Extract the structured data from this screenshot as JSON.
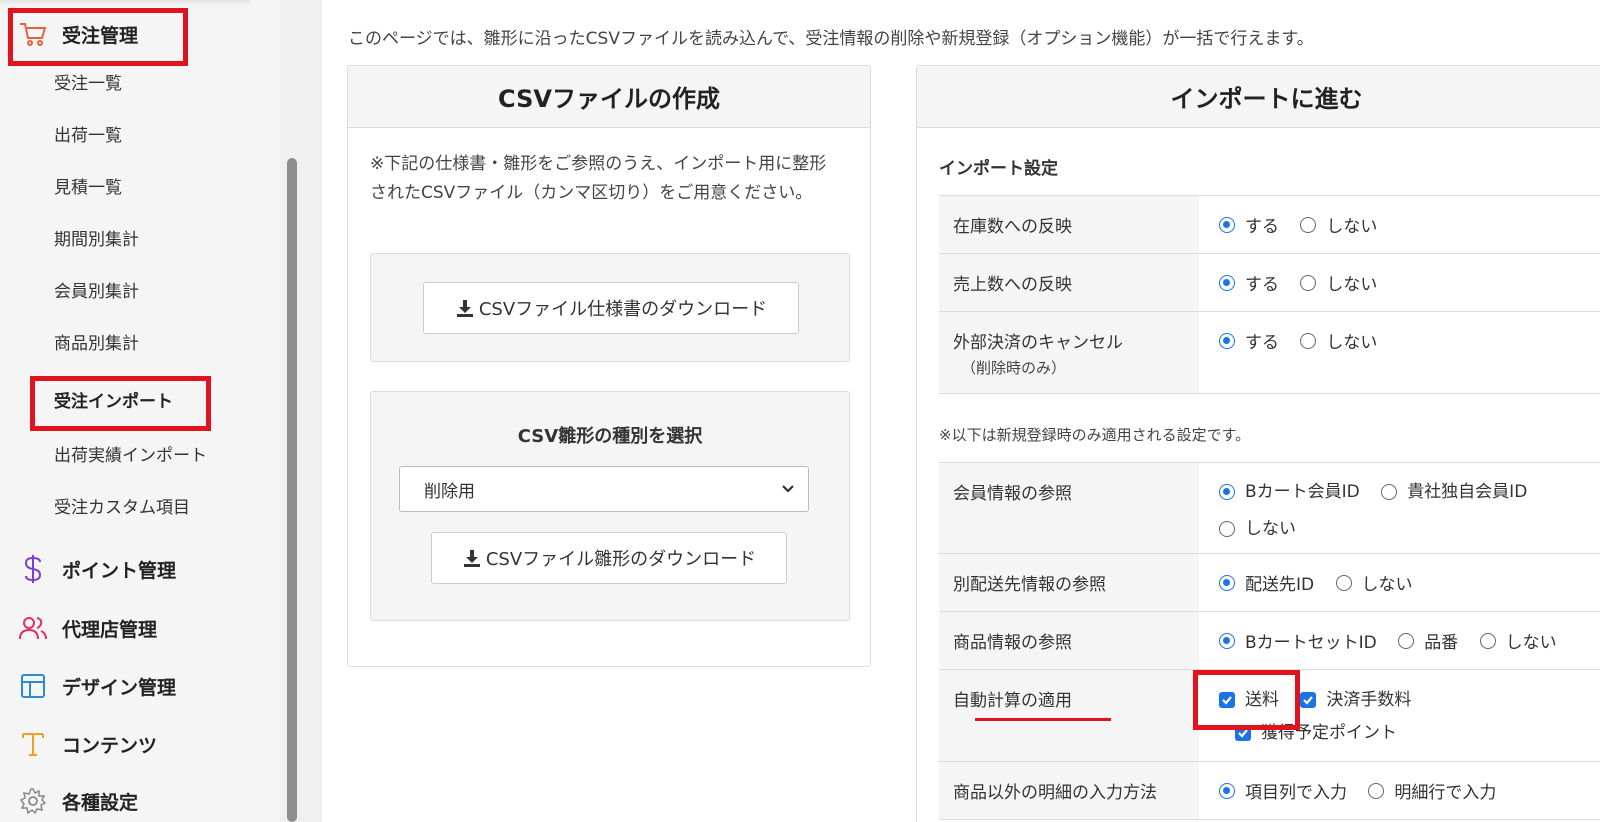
{
  "sidebar": {
    "order_management": "受注管理",
    "order_sub_items": [
      "受注一覧",
      "出荷一覧",
      "見積一覧",
      "期間別集計",
      "会員別集計",
      "商品別集計",
      "受注インポート",
      "出荷実績インポート",
      "受注カスタム項目"
    ],
    "point_management": "ポイント管理",
    "agency_management": "代理店管理",
    "design_management": "デザイン管理",
    "contents": "コンテンツ",
    "settings": "各種設定",
    "icon_colors": {
      "cart": "#e8603c",
      "point": "#7b3fd0",
      "agency": "#e0306e",
      "design": "#2b8ad6",
      "contents": "#f0a020",
      "settings": "#888888"
    }
  },
  "intro": "このページでは、雛形に沿ったCSVファイルを読み込んで、受注情報の削除や新規登録（オプション機能）が一括で行えます。",
  "csv_panel": {
    "title": "CSVファイルの作成",
    "note": "※下記の仕様書・雛形をご参照のうえ、インポート用に整形されたCSVファイル（カンマ区切り）をご用意ください。",
    "spec_download": "CSVファイル仕様書のダウンロード",
    "select_label": "CSV雛形の種別を選択",
    "select_value": "削除用",
    "template_download": "CSVファイル雛形のダウンロード"
  },
  "import_panel": {
    "title": "インポートに進む",
    "section_title": "インポート設定",
    "rows_top": [
      {
        "label": "在庫数への反映",
        "sub": "",
        "options": [
          "する",
          "しない"
        ],
        "selected": 0
      },
      {
        "label": "売上数への反映",
        "sub": "",
        "options": [
          "する",
          "しない"
        ],
        "selected": 0
      },
      {
        "label": "外部決済のキャンセル",
        "sub": "（削除時のみ）",
        "options": [
          "する",
          "しない"
        ],
        "selected": 0
      }
    ],
    "new_only_note": "※以下は新規登録時のみ適用される設定です。",
    "member_ref": {
      "label": "会員情報の参照",
      "options": [
        "Bカート会員ID",
        "貴社独自会員ID",
        "しない"
      ],
      "selected": 0
    },
    "shipping_ref": {
      "label": "別配送先情報の参照",
      "options": [
        "配送先ID",
        "しない"
      ],
      "selected": 0
    },
    "product_ref": {
      "label": "商品情報の参照",
      "options": [
        "BカートセットID",
        "品番",
        "しない"
      ],
      "selected": 0
    },
    "auto_calc": {
      "label": "自動計算の適用",
      "checks": [
        "送料",
        "決済手数料",
        "獲得予定ポイント"
      ]
    },
    "non_product": {
      "label": "商品以外の明細の入力方法",
      "options": [
        "項目列で入力",
        "明細行で入力"
      ],
      "selected": 0
    }
  },
  "accent": "#1a73e8",
  "highlight": "#e0141e"
}
